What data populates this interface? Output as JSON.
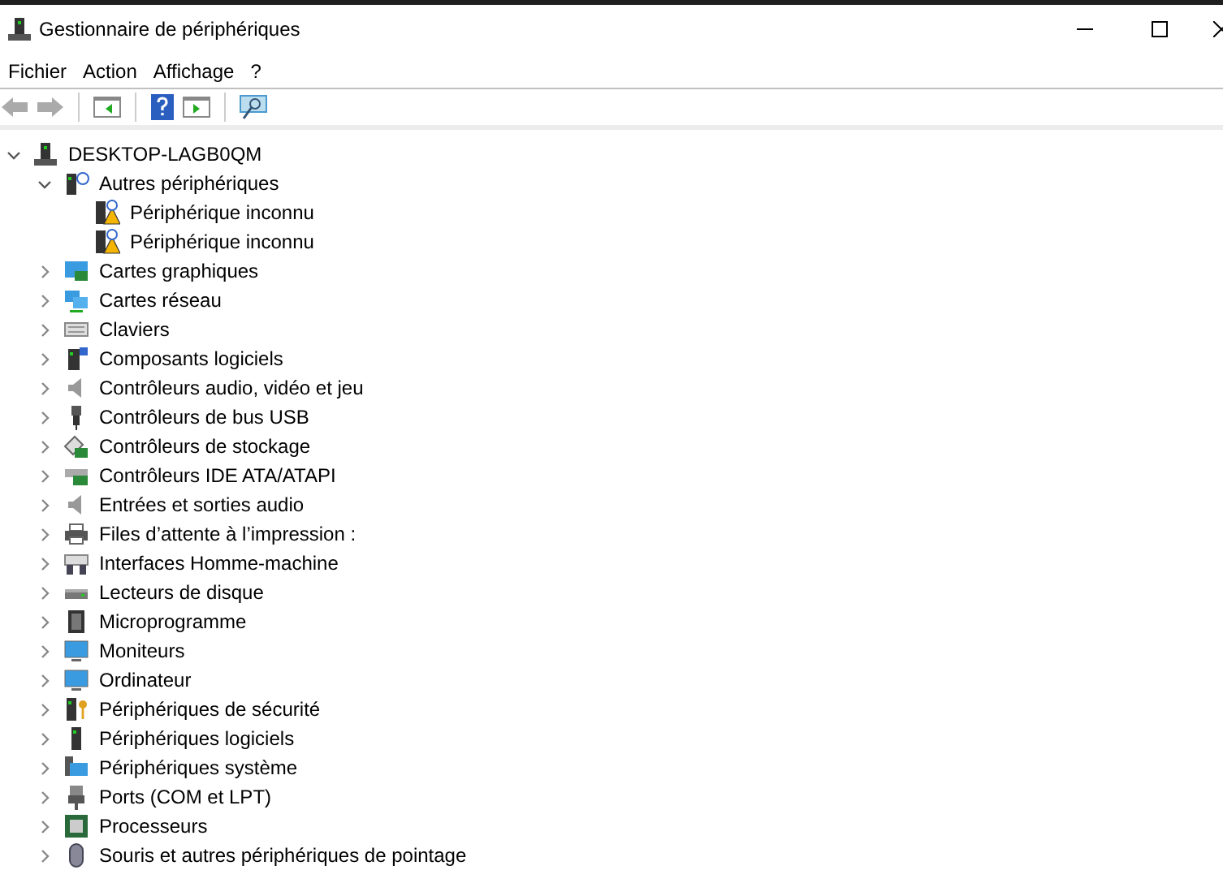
{
  "window": {
    "title": "Gestionnaire de périphériques"
  },
  "menu": [
    "Fichier",
    "Action",
    "Affichage",
    "?"
  ],
  "tree": [
    {
      "label": "DESKTOP-LAGB0QM",
      "kind": "computer",
      "expanded": true,
      "children": [
        {
          "label": "Autres périphériques",
          "kind": "other",
          "expanded": true,
          "children": [
            {
              "label": "Périphérique inconnu",
              "kind": "unknown"
            },
            {
              "label": "Périphérique inconnu",
              "kind": "unknown"
            }
          ]
        },
        {
          "label": "Cartes graphiques",
          "kind": "display",
          "expanded": false
        },
        {
          "label": "Cartes réseau",
          "kind": "network",
          "expanded": false
        },
        {
          "label": "Claviers",
          "kind": "keyboard",
          "expanded": false
        },
        {
          "label": "Composants logiciels",
          "kind": "software",
          "expanded": false
        },
        {
          "label": "Contrôleurs audio, vidéo et jeu",
          "kind": "audio",
          "expanded": false
        },
        {
          "label": "Contrôleurs de bus USB",
          "kind": "usb",
          "expanded": false
        },
        {
          "label": "Contrôleurs de stockage",
          "kind": "storage",
          "expanded": false
        },
        {
          "label": "Contrôleurs IDE ATA/ATAPI",
          "kind": "ide",
          "expanded": false
        },
        {
          "label": "Entrées et sorties audio",
          "kind": "audio",
          "expanded": false
        },
        {
          "label": "Files d’attente à l’impression :",
          "kind": "printer",
          "expanded": false
        },
        {
          "label": "Interfaces Homme-machine",
          "kind": "hid",
          "expanded": false
        },
        {
          "label": "Lecteurs de disque",
          "kind": "disk",
          "expanded": false
        },
        {
          "label": "Microprogramme",
          "kind": "firmware",
          "expanded": false
        },
        {
          "label": "Moniteurs",
          "kind": "monitor",
          "expanded": false
        },
        {
          "label": "Ordinateur",
          "kind": "monitor",
          "expanded": false
        },
        {
          "label": "Périphériques de sécurité",
          "kind": "security",
          "expanded": false
        },
        {
          "label": "Périphériques logiciels",
          "kind": "software2",
          "expanded": false
        },
        {
          "label": "Périphériques système",
          "kind": "system",
          "expanded": false
        },
        {
          "label": "Ports (COM et LPT)",
          "kind": "port",
          "expanded": false
        },
        {
          "label": "Processeurs",
          "kind": "processor",
          "expanded": false
        },
        {
          "label": "Souris et autres périphériques de pointage",
          "kind": "mouse",
          "expanded": false
        }
      ]
    }
  ]
}
